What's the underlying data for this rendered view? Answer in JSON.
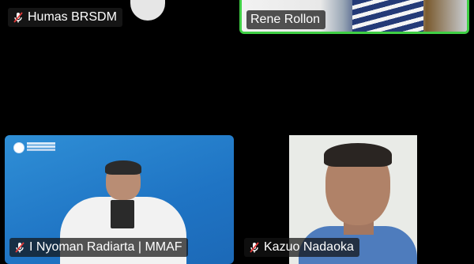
{
  "participants": [
    {
      "name": "Humas BRSDM",
      "muted": true
    },
    {
      "name": "Rene Rollon",
      "muted": false,
      "active_speaker": true
    },
    {
      "name": "I Nyoman Radiarta | MMAF",
      "muted": true
    },
    {
      "name": "Kazuo Nadaoka",
      "muted": true
    }
  ],
  "icons": {
    "muted_mic": "mic-muted-icon"
  },
  "colors": {
    "background": "#000000",
    "active_speaker_border": "#3fcf45",
    "mute_icon": "#e03a3a"
  }
}
